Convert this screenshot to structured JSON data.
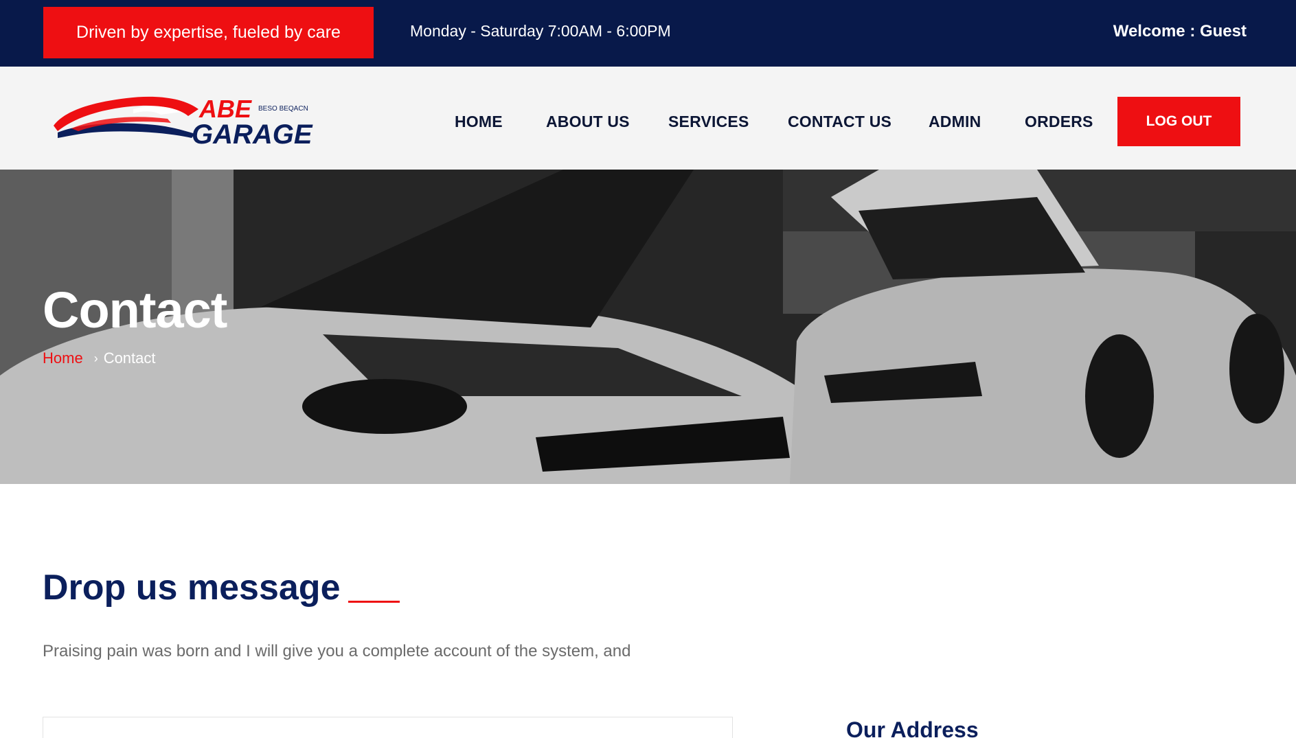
{
  "topbar": {
    "tagline": "Driven by expertise, fueled by care",
    "hours": "Monday - Saturday 7:00AM - 6:00PM",
    "welcome": "Welcome : Guest"
  },
  "logo": {
    "brand_top": "ABE",
    "brand_bottom": "GARAGE",
    "small_text": "BESO BEQACN"
  },
  "nav": {
    "items": [
      "HOME",
      "ABOUT US",
      "SERVICES",
      "CONTACT US",
      "ADMIN",
      "ORDERS"
    ],
    "logout_label": "LOG OUT"
  },
  "hero": {
    "title": "Contact",
    "breadcrumb_home": "Home",
    "breadcrumb_current": "Contact"
  },
  "content": {
    "heading": "Drop us message",
    "text": "Praising pain was born and I will give you a complete account of the system, and",
    "address_heading": "Our Address"
  },
  "colors": {
    "navy": "#08194a",
    "red": "#ee0f12",
    "heading_blue": "#0b1f5c"
  }
}
